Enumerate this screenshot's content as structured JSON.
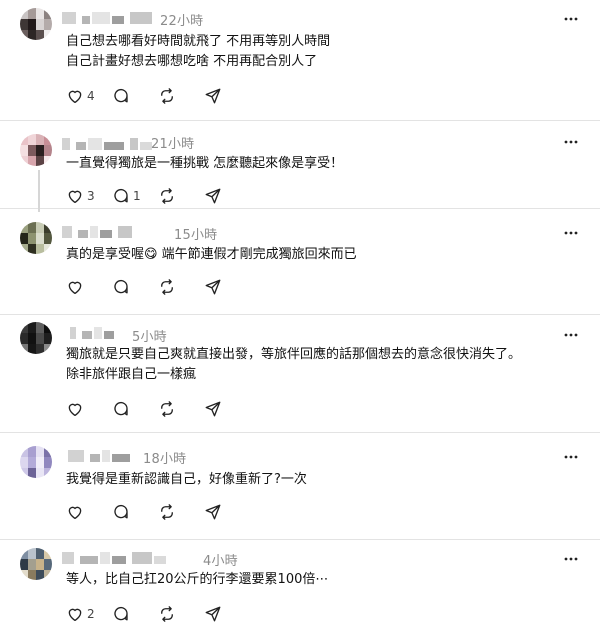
{
  "posts": [
    {
      "time": "22小時",
      "lines": [
        "自己想去哪看好時間就飛了 不用再等別人時間",
        "自己計畫好想去哪想吃啥 不用再配合別人了"
      ],
      "likes": "4",
      "replies": "",
      "avatar_colors": [
        "#c9c4c4",
        "#a59a98",
        "#e9e5e5",
        "#8c8281",
        "#3e3635",
        "#21191a",
        "#d8d3d3",
        "#b4abaa",
        "#6b5f5e",
        "#2d2625",
        "#5a4f4e",
        "#efeded"
      ]
    },
    {
      "time": "21小時",
      "lines": [
        "一直覺得獨旅是一種挑戰 怎麼聽起來像是享受！"
      ],
      "likes": "3",
      "replies": "1",
      "avatar_colors": [
        "#e9c3c8",
        "#f0d5d8",
        "#d9b2b6",
        "#c88e96",
        "#f4dfe1",
        "#7c5a5d",
        "#2a1f1f",
        "#b4848b",
        "#eed0d4",
        "#d7a5ac",
        "#5c4345",
        "#f7eaec"
      ]
    },
    {
      "time": "15小時",
      "lines": [
        "真的是享受喔😋 端午節連假才剛完成獨旅回來而已"
      ],
      "likes": "",
      "replies": "",
      "avatar_colors": [
        "#9aa07f",
        "#6b6f52",
        "#c7cbb4",
        "#3b3d2c",
        "#242519",
        "#8d9370",
        "#d9dccc",
        "#54583f",
        "#a7ad8e",
        "#2f3021",
        "#b9be9f",
        "#e5e7da"
      ]
    },
    {
      "time": "5小時",
      "lines": [
        "獨旅就是只要自己爽就直接出發，等旅伴回應的話那個想去的意念很快消失了。",
        "除非旅伴跟自己一樣瘋"
      ],
      "likes": "",
      "replies": "",
      "avatar_colors": [
        "#3b3b3b",
        "#1b1b1b",
        "#5f5f5f",
        "#0d0d0d",
        "#2a2a2a",
        "#111111",
        "#4a4a4a",
        "#1f1f1f",
        "#777777",
        "#161616",
        "#2f2f2f",
        "#8a8a8a"
      ]
    },
    {
      "time": "18小時",
      "lines": [
        "我覺得是重新認識自己，好像重新了?一次"
      ],
      "likes": "",
      "replies": "",
      "avatar_colors": [
        "#c9c3e4",
        "#a89fd0",
        "#e5e1f3",
        "#7b72a9",
        "#dcd7ef",
        "#b3abd9",
        "#f1eef9",
        "#9188bf",
        "#cfc9e8",
        "#6c6397",
        "#e9e6f5",
        "#bdb5dd"
      ]
    },
    {
      "time": "4小時",
      "lines": [
        "等人，比自己扛20公斤的行李還要累100倍⋯"
      ],
      "likes": "2",
      "replies": "",
      "avatar_colors": [
        "#7f8fa3",
        "#b9c2cc",
        "#4e5f70",
        "#d8c9a8",
        "#2d3a47",
        "#a39f8f",
        "#c7b28a",
        "#56687a",
        "#e3dccb",
        "#8a7b5e",
        "#3e4c5a",
        "#bfb49b"
      ]
    }
  ]
}
